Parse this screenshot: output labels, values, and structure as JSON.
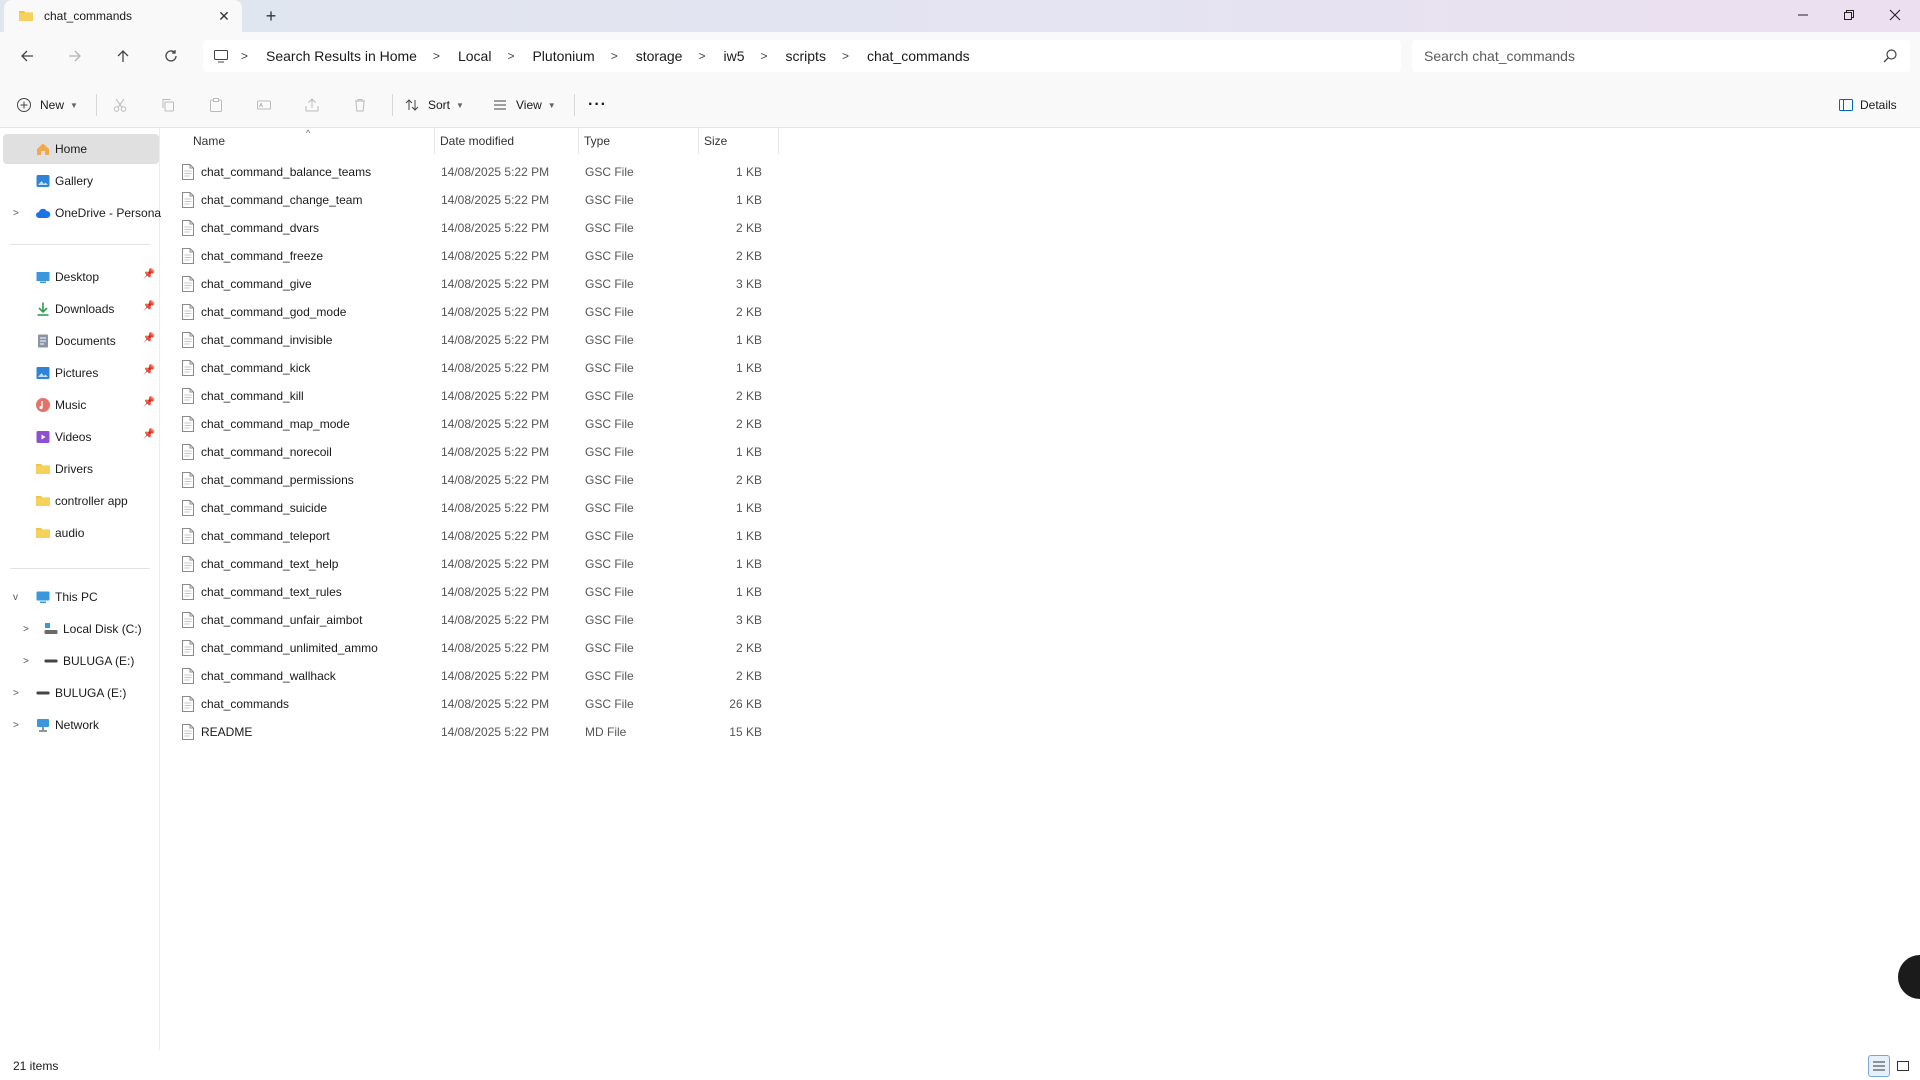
{
  "window": {
    "tab_title": "chat_commands",
    "new_tab_symbol": "+",
    "close_tab_symbol": "✕"
  },
  "address": {
    "crumbs": [
      "Search Results in Home",
      "Local",
      "Plutonium",
      "storage",
      "iw5",
      "scripts",
      "chat_commands"
    ],
    "search_placeholder": "Search chat_commands"
  },
  "toolbar": {
    "new_label": "New",
    "sort_label": "Sort",
    "view_label": "View",
    "more_label": "···",
    "details_label": "Details"
  },
  "sidebar": {
    "home": "Home",
    "gallery": "Gallery",
    "onedrive": "OneDrive - Personal",
    "desktop": "Desktop",
    "downloads": "Downloads",
    "documents": "Documents",
    "pictures": "Pictures",
    "music": "Music",
    "videos": "Videos",
    "drivers": "Drivers",
    "controller_app": "controller app",
    "audio": "audio",
    "this_pc": "This PC",
    "local_disk": "Local Disk (C:)",
    "buluga_sub": "BULUGA (E:)",
    "buluga": "BULUGA (E:)",
    "network": "Network"
  },
  "columns": {
    "name": "Name",
    "date": "Date modified",
    "type": "Type",
    "size": "Size"
  },
  "files": [
    {
      "name": "chat_command_balance_teams",
      "date": "14/08/2025 5:22 PM",
      "type": "GSC File",
      "size": "1 KB"
    },
    {
      "name": "chat_command_change_team",
      "date": "14/08/2025 5:22 PM",
      "type": "GSC File",
      "size": "1 KB"
    },
    {
      "name": "chat_command_dvars",
      "date": "14/08/2025 5:22 PM",
      "type": "GSC File",
      "size": "2 KB"
    },
    {
      "name": "chat_command_freeze",
      "date": "14/08/2025 5:22 PM",
      "type": "GSC File",
      "size": "2 KB"
    },
    {
      "name": "chat_command_give",
      "date": "14/08/2025 5:22 PM",
      "type": "GSC File",
      "size": "3 KB"
    },
    {
      "name": "chat_command_god_mode",
      "date": "14/08/2025 5:22 PM",
      "type": "GSC File",
      "size": "2 KB"
    },
    {
      "name": "chat_command_invisible",
      "date": "14/08/2025 5:22 PM",
      "type": "GSC File",
      "size": "1 KB"
    },
    {
      "name": "chat_command_kick",
      "date": "14/08/2025 5:22 PM",
      "type": "GSC File",
      "size": "1 KB"
    },
    {
      "name": "chat_command_kill",
      "date": "14/08/2025 5:22 PM",
      "type": "GSC File",
      "size": "2 KB"
    },
    {
      "name": "chat_command_map_mode",
      "date": "14/08/2025 5:22 PM",
      "type": "GSC File",
      "size": "2 KB"
    },
    {
      "name": "chat_command_norecoil",
      "date": "14/08/2025 5:22 PM",
      "type": "GSC File",
      "size": "1 KB"
    },
    {
      "name": "chat_command_permissions",
      "date": "14/08/2025 5:22 PM",
      "type": "GSC File",
      "size": "2 KB"
    },
    {
      "name": "chat_command_suicide",
      "date": "14/08/2025 5:22 PM",
      "type": "GSC File",
      "size": "1 KB"
    },
    {
      "name": "chat_command_teleport",
      "date": "14/08/2025 5:22 PM",
      "type": "GSC File",
      "size": "1 KB"
    },
    {
      "name": "chat_command_text_help",
      "date": "14/08/2025 5:22 PM",
      "type": "GSC File",
      "size": "1 KB"
    },
    {
      "name": "chat_command_text_rules",
      "date": "14/08/2025 5:22 PM",
      "type": "GSC File",
      "size": "1 KB"
    },
    {
      "name": "chat_command_unfair_aimbot",
      "date": "14/08/2025 5:22 PM",
      "type": "GSC File",
      "size": "3 KB"
    },
    {
      "name": "chat_command_unlimited_ammo",
      "date": "14/08/2025 5:22 PM",
      "type": "GSC File",
      "size": "2 KB"
    },
    {
      "name": "chat_command_wallhack",
      "date": "14/08/2025 5:22 PM",
      "type": "GSC File",
      "size": "2 KB"
    },
    {
      "name": "chat_commands",
      "date": "14/08/2025 5:22 PM",
      "type": "GSC File",
      "size": "26 KB"
    },
    {
      "name": "README",
      "date": "14/08/2025 5:22 PM",
      "type": "MD File",
      "size": "15 KB"
    }
  ],
  "status": {
    "item_count": "21 items"
  },
  "colors": {
    "folder": "#f5c542",
    "selected": "#e0e0e0",
    "accent": "#0067c0"
  }
}
